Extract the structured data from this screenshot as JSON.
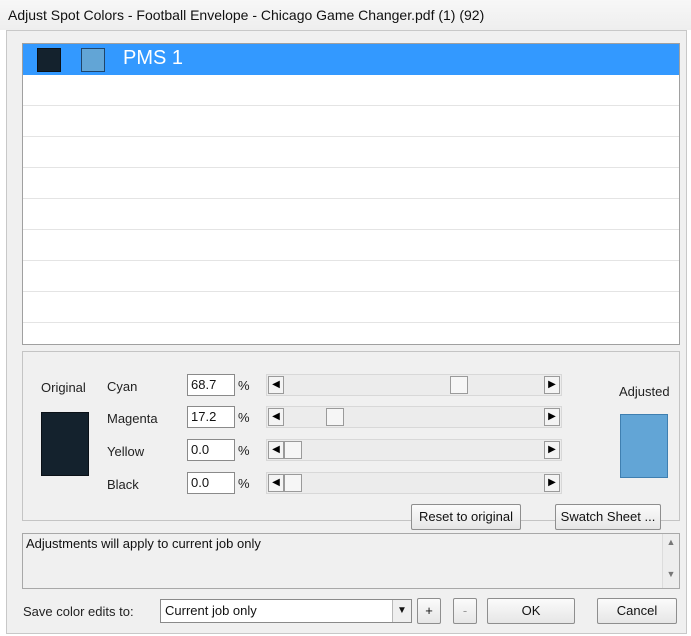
{
  "window": {
    "title": "Adjust Spot Colors - Football Envelope - Chicago Game Changer.pdf (1) (92)"
  },
  "colors": {
    "original": "#14222d",
    "adjusted": "#62a5d6",
    "selection": "#3399ff"
  },
  "list": {
    "items": [
      {
        "label": "PMS 1",
        "selected": true
      }
    ]
  },
  "panel": {
    "original_label": "Original",
    "adjusted_label": "Adjusted",
    "channels": [
      {
        "name": "Cyan",
        "value": "68.7",
        "unit": "%",
        "fraction": 0.687
      },
      {
        "name": "Magenta",
        "value": "17.2",
        "unit": "%",
        "fraction": 0.172
      },
      {
        "name": "Yellow",
        "value": "0.0",
        "unit": "%",
        "fraction": 0.0
      },
      {
        "name": "Black",
        "value": "0.0",
        "unit": "%",
        "fraction": 0.0
      }
    ],
    "reset_label": "Reset to original",
    "swatch_label": "Swatch Sheet ..."
  },
  "notes": {
    "text": "Adjustments will apply to current job only"
  },
  "footer": {
    "save_label": "Save color edits to:",
    "save_option": "Current job only",
    "plus_label": "+",
    "minus_label": "-",
    "ok_label": "OK",
    "cancel_label": "Cancel"
  }
}
